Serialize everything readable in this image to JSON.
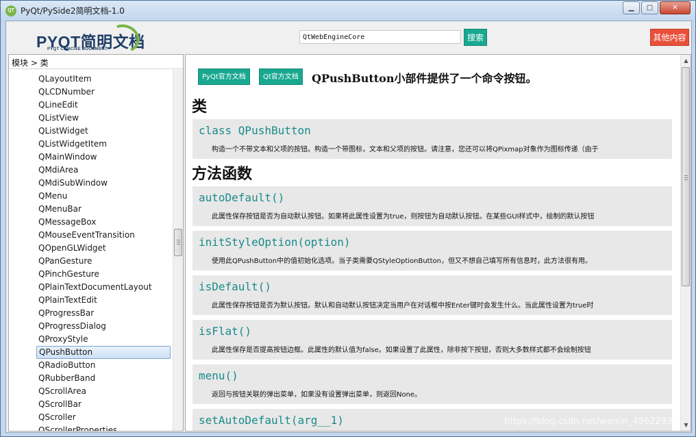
{
  "window": {
    "title": "PyQt/PySide2简明文档-1.0",
    "icon_text": "QT",
    "minimize_glyph": "▁",
    "maximize_glyph": "□",
    "close_glyph": "✕"
  },
  "header": {
    "logo_main": "PYQT简明文档",
    "logo_sub": "PYQT CONCISE DOCUMENT",
    "search_value": "QtWebEngineCore",
    "search_button": "搜索",
    "other_button": "其他内容"
  },
  "sidebar": {
    "breadcrumb": "模块 > 类",
    "items": [
      "QLayoutItem",
      "QLCDNumber",
      "QLineEdit",
      "QListView",
      "QListWidget",
      "QListWidgetItem",
      "QMainWindow",
      "QMdiArea",
      "QMdiSubWindow",
      "QMenu",
      "QMenuBar",
      "QMessageBox",
      "QMouseEventTransition",
      "QOpenGLWidget",
      "QPanGesture",
      "QPinchGesture",
      "QPlainTextDocumentLayout",
      "QPlainTextEdit",
      "QProgressBar",
      "QProgressDialog",
      "QProxyStyle",
      "QPushButton",
      "QRadioButton",
      "QRubberBand",
      "QScrollArea",
      "QScrollBar",
      "QScroller",
      "QScrollerProperties"
    ],
    "selected": "QPushButton"
  },
  "doc": {
    "pyqt_doc_button": "PyQt官方文档",
    "qt_doc_button": "Qt官方文档",
    "heading": "QPushButton小部件提供了一个命令按钮。",
    "class_section": "类",
    "methods_section": "方法函数",
    "class_card": {
      "name": "class QPushButton",
      "desc": "构造一个不带文本和父项的按钮。构造一个带图标，文本和父项的按钮。请注意，您还可以将QPixmap对象作为图标传递（由于"
    },
    "methods": [
      {
        "name": "autoDefault()",
        "desc": "此属性保存按钮是否为自动默认按钮。如果将此属性设置为true，则按钮为自动默认按钮。在某些GUI样式中，绘制的默认按钮"
      },
      {
        "name": "initStyleOption(option)",
        "desc": "使用此QPushButton中的值初始化选项。当子类需要QStyleOptionButton，但又不想自己填写所有信息时，此方法很有用。"
      },
      {
        "name": "isDefault()",
        "desc": "此属性保存按钮是否为默认按钮。默认和自动默认按钮决定当用户在对话框中按Enter键时会发生什么。当此属性设置为true时"
      },
      {
        "name": "isFlat()",
        "desc": "此属性保存是否提高按钮边框。此属性的默认值为false。如果设置了此属性，除非按下按钮，否则大多数样式都不会绘制按钮"
      },
      {
        "name": "menu()",
        "desc": "返回与按钮关联的弹出菜单，如果没有设置弹出菜单，则返回None。"
      },
      {
        "name": "setAutoDefault(arg__1)",
        "desc": ""
      }
    ]
  },
  "watermark": "https://blog.csdn.net/weixin_4562293",
  "colors": {
    "accent_green": "#19a890",
    "accent_red": "#e8503a",
    "method_name": "#1a8a8a",
    "card_bg": "#e8e8e8"
  }
}
